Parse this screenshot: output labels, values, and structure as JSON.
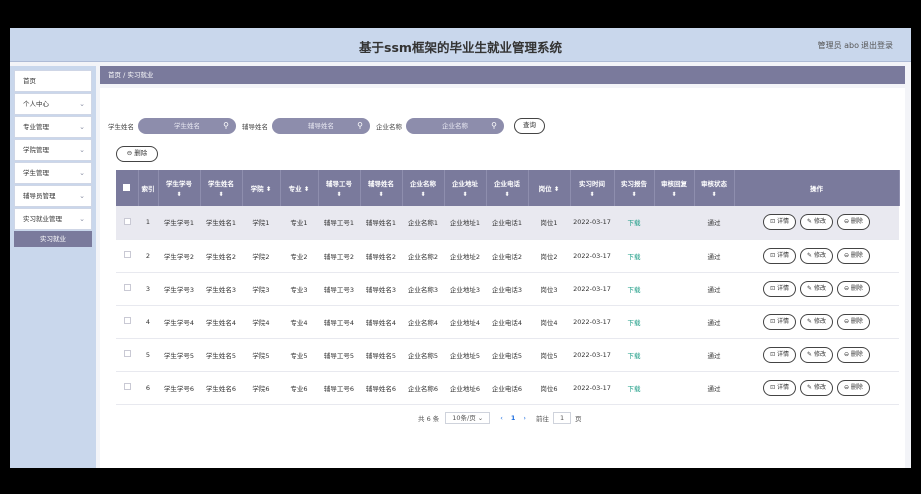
{
  "header": {
    "title": "基于ssm框架的毕业生就业管理系统",
    "user": "管理员 abo",
    "logout": "退出登录"
  },
  "sidebar": {
    "items": [
      {
        "label": "首页",
        "chev": ""
      },
      {
        "label": "个人中心",
        "chev": "⌄"
      },
      {
        "label": "专业管理",
        "chev": "⌄"
      },
      {
        "label": "学院管理",
        "chev": "⌄"
      },
      {
        "label": "学生管理",
        "chev": "⌄"
      },
      {
        "label": "辅导员管理",
        "chev": "⌄"
      },
      {
        "label": "实习就业管理",
        "chev": "⌄"
      }
    ],
    "sub_item": "实习就业"
  },
  "breadcrumb": "首页 / 实习就业",
  "search": {
    "student_name_label": "学生姓名",
    "student_name_placeholder": "学生姓名",
    "counselor_name_label": "辅导姓名",
    "counselor_name_placeholder": "辅导姓名",
    "company_label": "企业名称",
    "company_placeholder": "企业名称",
    "query": "查询"
  },
  "delete_button": "⊖ 删除",
  "table": {
    "headers": [
      "索引",
      "学生学号",
      "学生姓名",
      "学院",
      "专业",
      "辅导工号",
      "辅导姓名",
      "企业名称",
      "企业地址",
      "企业电话",
      "岗位",
      "实习时间",
      "实习报告",
      "审核回复",
      "审核状态",
      "操作"
    ],
    "sort_icon": "⬍",
    "rows": [
      {
        "idx": "1",
        "sno": "学生学号1",
        "sname": "学生姓名1",
        "college": "学院1",
        "major": "专业1",
        "tno": "辅导工号1",
        "tname": "辅导姓名1",
        "cname": "企业名称1",
        "caddr": "企业地址1",
        "cphone": "企业电话1",
        "post": "岗位1",
        "time": "2022-03-17",
        "report": "下载",
        "reply": "",
        "status": "通过"
      },
      {
        "idx": "2",
        "sno": "学生学号2",
        "sname": "学生姓名2",
        "college": "学院2",
        "major": "专业2",
        "tno": "辅导工号2",
        "tname": "辅导姓名2",
        "cname": "企业名称2",
        "caddr": "企业地址2",
        "cphone": "企业电话2",
        "post": "岗位2",
        "time": "2022-03-17",
        "report": "下载",
        "reply": "",
        "status": "通过"
      },
      {
        "idx": "3",
        "sno": "学生学号3",
        "sname": "学生姓名3",
        "college": "学院3",
        "major": "专业3",
        "tno": "辅导工号3",
        "tname": "辅导姓名3",
        "cname": "企业名称3",
        "caddr": "企业地址3",
        "cphone": "企业电话3",
        "post": "岗位3",
        "time": "2022-03-17",
        "report": "下载",
        "reply": "",
        "status": "通过"
      },
      {
        "idx": "4",
        "sno": "学生学号4",
        "sname": "学生姓名4",
        "college": "学院4",
        "major": "专业4",
        "tno": "辅导工号4",
        "tname": "辅导姓名4",
        "cname": "企业名称4",
        "caddr": "企业地址4",
        "cphone": "企业电话4",
        "post": "岗位4",
        "time": "2022-03-17",
        "report": "下载",
        "reply": "",
        "status": "通过"
      },
      {
        "idx": "5",
        "sno": "学生学号5",
        "sname": "学生姓名5",
        "college": "学院5",
        "major": "专业5",
        "tno": "辅导工号5",
        "tname": "辅导姓名5",
        "cname": "企业名称5",
        "caddr": "企业地址5",
        "cphone": "企业电话5",
        "post": "岗位5",
        "time": "2022-03-17",
        "report": "下载",
        "reply": "",
        "status": "通过"
      },
      {
        "idx": "6",
        "sno": "学生学号6",
        "sname": "学生姓名6",
        "college": "学院6",
        "major": "专业6",
        "tno": "辅导工号6",
        "tname": "辅导姓名6",
        "cname": "企业名称6",
        "caddr": "企业地址6",
        "cphone": "企业电话6",
        "post": "岗位6",
        "time": "2022-03-17",
        "report": "下载",
        "reply": "",
        "status": "通过"
      }
    ],
    "actions": {
      "detail": "⊡ 详情",
      "edit": "✎ 修改",
      "delete": "⊖ 删除"
    }
  },
  "pager": {
    "total": "共 6 条",
    "page_size": "10条/页 ⌄",
    "prev": "‹",
    "current": "1",
    "next": "›",
    "goto_label": "前往",
    "goto_value": "1",
    "page_unit": "页"
  }
}
